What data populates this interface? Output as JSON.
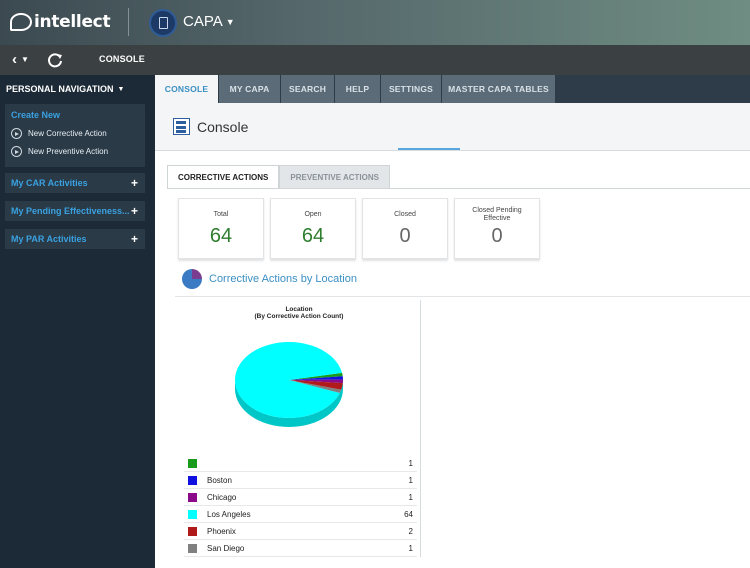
{
  "header": {
    "logo_text": "intellect",
    "app_name": "CAPA"
  },
  "subbar": {
    "breadcrumb": "CONSOLE"
  },
  "sidebar": {
    "title": "PERSONAL NAVIGATION",
    "create_new": {
      "label": "Create New",
      "items": [
        "New Corrective Action",
        "New Preventive Action"
      ]
    },
    "sections": [
      "My CAR Activities",
      "My Pending Effectiveness...",
      "My PAR Activities"
    ]
  },
  "tabs": [
    "CONSOLE",
    "MY CAPA",
    "SEARCH",
    "HELP",
    "SETTINGS",
    "MASTER CAPA TABLES"
  ],
  "active_tab": "CONSOLE",
  "page": {
    "title": "Console"
  },
  "subtabs": [
    "CORRECTIVE ACTIONS",
    "PREVENTIVE ACTIONS"
  ],
  "cards": [
    {
      "label": "Total",
      "value": "64"
    },
    {
      "label": "Open",
      "value": "64"
    },
    {
      "label": "Closed",
      "value": "0"
    },
    {
      "label": "Closed Pending Effective",
      "value": "0"
    }
  ],
  "section": {
    "title": "Corrective Actions by Location"
  },
  "chart_data": {
    "type": "pie",
    "title": "Location",
    "subtitle": "(By Corrective Action Count)",
    "categories": [
      "",
      "Boston",
      "Chicago",
      "Los Angeles",
      "Phoenix",
      "San Diego"
    ],
    "values": [
      1,
      1,
      1,
      64,
      2,
      1
    ],
    "colors": [
      "#1a9a1a",
      "#1010e0",
      "#8a0a8a",
      "#00ffff",
      "#b01a1a",
      "#808080"
    ]
  },
  "colors": {
    "accent": "#3b8fc4",
    "topbar": "#55676b",
    "sidebar": "#1b2a36",
    "green_value": "#2f7d2f"
  }
}
